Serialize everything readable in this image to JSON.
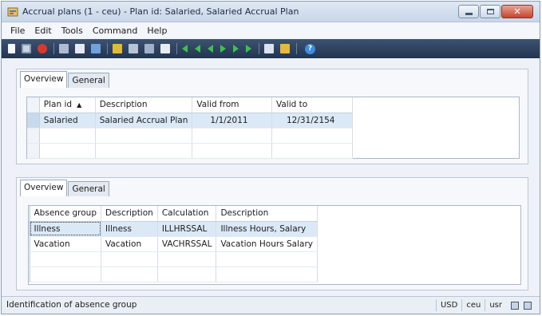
{
  "window": {
    "title": "Accrual plans (1 - ceu) - Plan id: Salaried, Salaried Accrual Plan",
    "close_glyph": "✕"
  },
  "menu": [
    "File",
    "Edit",
    "Tools",
    "Command",
    "Help"
  ],
  "toolbar": {
    "help_glyph": "?"
  },
  "plans_panel": {
    "tabs": [
      "Overview",
      "General"
    ],
    "columns": [
      "Plan id",
      "Description",
      "Valid from",
      "Valid to"
    ],
    "sort_indicator": "▲",
    "rows": [
      {
        "plan_id": "Salaried",
        "description": "Salaried Accrual Plan",
        "valid_from": "1/1/2011",
        "valid_to": "12/31/2154"
      }
    ]
  },
  "absence_panel": {
    "tabs": [
      "Overview",
      "General"
    ],
    "columns": [
      "Absence group",
      "Description",
      "Calculation",
      "Description"
    ],
    "rows": [
      {
        "absence_group": "Illness",
        "description": "Illness",
        "calculation": "ILLHRSSAL",
        "calc_description": "Illness Hours, Salary"
      },
      {
        "absence_group": "Vacation",
        "description": "Vacation",
        "calculation": "VACHRSSAL",
        "calc_description": "Vacation Hours Salary"
      }
    ]
  },
  "status": {
    "text": "Identification of absence group",
    "currency": "USD",
    "company": "ceu",
    "user": "usr"
  },
  "colors": {
    "toolbar_bg": "#223550",
    "selected_row": "#dbe9f7",
    "close_button": "#c6442d"
  }
}
